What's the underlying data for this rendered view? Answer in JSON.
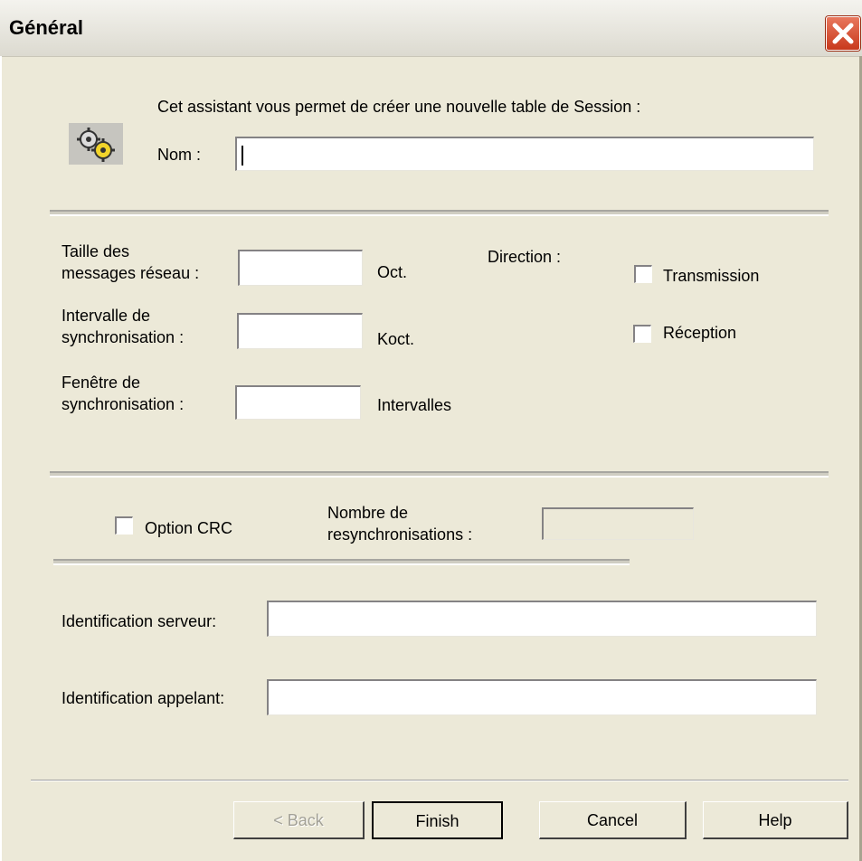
{
  "window": {
    "title": "Général"
  },
  "colors": {
    "dialog_bg": "#ece9d8",
    "close_red": "#c8391c"
  },
  "icons": {
    "wizard": "gears-icon",
    "close": "close-icon"
  },
  "intro": {
    "text": "Cet assistant vous permet de créer une nouvelle table de Session :",
    "name_label": "Nom :",
    "name_value": ""
  },
  "network": {
    "msg_size_label": "Taille des\nmessages réseau :",
    "msg_size_value": "",
    "msg_size_unit": "Oct.",
    "sync_interval_label": "Intervalle de\nsynchronisation  :",
    "sync_interval_value": "",
    "sync_interval_unit": "Koct.",
    "sync_window_label": "Fenêtre de\nsynchronisation  :",
    "sync_window_value": "",
    "sync_window_unit": "Intervalles"
  },
  "direction": {
    "label": "Direction :",
    "transmission_label": "Transmission",
    "transmission_checked": false,
    "reception_label": "Réception",
    "reception_checked": false
  },
  "crc": {
    "label": "Option CRC",
    "checked": false,
    "resync_label": "Nombre de\nresynchronisations :",
    "resync_value": ""
  },
  "identification": {
    "server_label": "Identification serveur:",
    "server_value": "",
    "caller_label": "Identification appelant:",
    "caller_value": ""
  },
  "buttons": {
    "back": "< Back",
    "finish": "Finish",
    "cancel": "Cancel",
    "help": "Help"
  }
}
